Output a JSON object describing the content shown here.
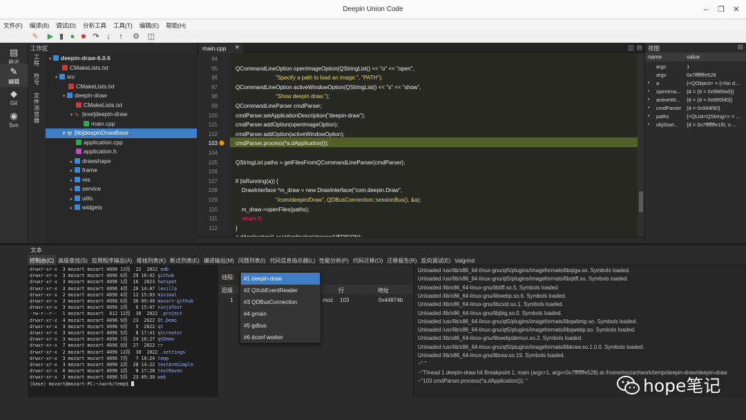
{
  "window": {
    "title": "Deepin Union Code"
  },
  "menu": [
    "文件(F)",
    "编译(B)",
    "调试(D)",
    "分析工具",
    "工具(T)",
    "编辑(E)",
    "帮助(H)"
  ],
  "activity_bar": [
    {
      "label": "最近",
      "icon": "clock-icon"
    },
    {
      "label": "编辑",
      "icon": "edit-icon"
    },
    {
      "label": "Git",
      "icon": "git-icon"
    },
    {
      "label": "Svn",
      "icon": "svn-icon"
    }
  ],
  "workspace": {
    "title": "工作区",
    "vertical_tabs": [
      "工程",
      "符号",
      "文件浏览器"
    ],
    "tree": [
      {
        "label": "deepin-draw-6.0.6",
        "type": "project",
        "expanded": true
      },
      {
        "label": "CMakeLists.txt",
        "type": "cmake"
      },
      {
        "label": "src",
        "type": "folder",
        "expanded": true
      },
      {
        "label": "CMakeLists.txt",
        "type": "cmake"
      },
      {
        "label": "deepin-draw",
        "type": "folder",
        "expanded": true
      },
      {
        "label": "CMakeLists.txt",
        "type": "cmake"
      },
      {
        "label": "[exe]deepin-draw",
        "type": "exe",
        "expanded": true
      },
      {
        "label": "main.cpp",
        "type": "cpp"
      },
      {
        "label": "[lib]deepinDrawBase",
        "type": "lib",
        "expanded": true,
        "selected": true
      },
      {
        "label": "application.cpp",
        "type": "cpp"
      },
      {
        "label": "application.h",
        "type": "header"
      },
      {
        "label": "drawshape",
        "type": "folder"
      },
      {
        "label": "frame",
        "type": "folder"
      },
      {
        "label": "res",
        "type": "folder"
      },
      {
        "label": "service",
        "type": "folder"
      },
      {
        "label": "utils",
        "type": "folder"
      },
      {
        "label": "widgets",
        "type": "folder"
      }
    ]
  },
  "editor": {
    "tab": "main.cpp",
    "current_line": 103,
    "lines": [
      {
        "n": "94",
        "code": ""
      },
      {
        "n": "95",
        "code": "QCommandLineOption openImageOption(QStringList() << \"o\" << \"open\","
      },
      {
        "n": "96",
        "code": "                          \"Specify a path to load an image.\", \"PATH\");"
      },
      {
        "n": "97",
        "code": "QCommandLineOption activeWindowOption(QStringList() << \"s\" << \"show\","
      },
      {
        "n": "98",
        "code": "                          \"Show deepin draw.\");"
      },
      {
        "n": "99",
        "code": "QCommandLineParser cmdParser;"
      },
      {
        "n": "100",
        "code": "cmdParser.setApplicationDescription(\"deepin-draw\");"
      },
      {
        "n": "101",
        "code": "cmdParser.addOption(openImageOption);"
      },
      {
        "n": "102",
        "code": "cmdParser.addOption(activeWindowOption);"
      },
      {
        "n": "103",
        "code": "cmdParser.process(*a.dApplication());"
      },
      {
        "n": "104",
        "code": ""
      },
      {
        "n": "105",
        "code": "QStringList paths = getFilesFromQCommandLineParser(cmdParser);"
      },
      {
        "n": "106",
        "code": ""
      },
      {
        "n": "107",
        "code": "if (isRunning(a)) {"
      },
      {
        "n": "108",
        "code": "    DrawInterface *m_draw = new DrawInterface(\"com.deepin.Draw\","
      },
      {
        "n": "109",
        "code": "                          \"/com/deepin/Draw\", QDBusConnection::sessionBus(), &a);"
      },
      {
        "n": "110",
        "code": "    m_draw->openFiles(paths);"
      },
      {
        "n": "111",
        "code": "    return 0;"
      },
      {
        "n": "112",
        "code": "}"
      },
      {
        "n": "113",
        "code": "a.dApplication()->setApplicationVersion(VERSION);"
      }
    ]
  },
  "variables": {
    "title": "视图",
    "headers": {
      "name": "name",
      "value": "value"
    },
    "rows": [
      {
        "name": "argc",
        "value": "1"
      },
      {
        "name": "argv",
        "value": "0x7fffffffe528"
      },
      {
        "name": "a",
        "value": "{<QObject> = {<No d..."
      },
      {
        "name": "openIma...",
        "value": "{d = {d = 0x9960a0}}"
      },
      {
        "name": "activeWi...",
        "value": "{d = {d = 0x995fd0}}"
      },
      {
        "name": "cmdParser",
        "value": "{d = 0x994f90}"
      },
      {
        "name": "paths",
        "value": "{<QList<QString>> = ..."
      },
      {
        "name": "objStart...",
        "value": "{d = 0x7fffffffe1f0, o ..."
      }
    ]
  },
  "bottom": {
    "title": "文本",
    "tabs": [
      "控制台(C)",
      "高级查找(S)",
      "应用程序输出(A)",
      "堆栈列表(K)",
      "断点列表(E)",
      "编译输出(M)",
      "问题列表(I)",
      "代码信息指示器(L)",
      "性能分析(P)",
      "代码迁移(O)",
      "迁移报告(R)",
      "反向调试(E)",
      "Valgrind"
    ],
    "terminal": [
      {
        "meta": "drwxr-xr-x  3 mozart mozart 4096 12月  22  2022 ",
        "name": "edb"
      },
      {
        "meta": "drwxr-xr-x  3 mozart mozart 4096 6月  29 16:42 ",
        "name": "github"
      },
      {
        "meta": "drwxr-xr-x  3 mozart mozart 4096 1月  16  2023 ",
        "name": "hotspot"
      },
      {
        "meta": "drwxr-xr-x  3 mozart mozart 4096 4月  26 14:07 ",
        "name": "lexilla"
      },
      {
        "meta": "drwxr-xr-x  2 mozart mozart 4096 4月  12 15:03 ",
        "name": "minimal"
      },
      {
        "meta": "drwxr-xr-x  3 mozart mozart 4096 6月  30 09:49 ",
        "name": "mozart-github"
      },
      {
        "meta": "drwxr-xr-x  3 mozart mozart 4096 2月   6 15:47 ",
        "name": "ninjaTest"
      },
      {
        "meta": "-rw-r--r--  1 mozart mozart  812 12月  30  2022 ",
        "name": ".project"
      },
      {
        "meta": "drwxr-xr-x  4 mozart mozart 4096 9月  23  2022 ",
        "name": "Qt.Demo"
      },
      {
        "meta": "drwxr-xr-x  3 mozart mozart 4096 9月   5  2022 ",
        "name": "qt"
      },
      {
        "meta": "drwxr-xr-x  3 mozart mozart 4096 5月   8 17:41 ",
        "name": "qtcreator"
      },
      {
        "meta": "drwxr-xr-x  3 mozart mozart 4096 7月  24 18:27 ",
        "name": "qtDemo"
      },
      {
        "meta": "drwxr-xr-x  7 mozart mozart 4096 9月  27  2022 ",
        "name": "rr"
      },
      {
        "meta": "drwxr-xr-x  2 mozart mozart 4096 12月  30  2022 ",
        "name": ".settings"
      },
      {
        "meta": "drwxr-xr-x  3 mozart mozart 4096 7月   7 10:24 ",
        "name": "temp"
      },
      {
        "meta": "drwxr-xr-x  3 mozart mozart 4096 2月  28 14:22 ",
        "name": "testArmSimple"
      },
      {
        "meta": "drwxr-xr-x  6 mozart mozart 4096 3月   8 17:20 ",
        "name": "testRaven"
      },
      {
        "meta": "drwxr-xr-x  3 mozart mozart 4096 5月  23 09:30 ",
        "name": "web"
      },
      {
        "meta": "(base) mozart@mozart-PC:~/work/temp$ ",
        "name": ""
      }
    ],
    "threads": {
      "label": "线程:",
      "level_header": "层级",
      "col_line": "行",
      "col_addr": "地址",
      "row": {
        "level": "1",
        "file": "moz",
        "line": "103",
        "addr": "0x44874b"
      },
      "options": [
        "#1 deepin-draw",
        "#2 QXcbEventReader",
        "#3 QDBusConnection",
        "#4 gmain",
        "#5 gdbus",
        "#6 dconf worker"
      ]
    },
    "log": [
      "Unloaded /usr/lib/x86_64-linux-gnu/qt5/plugins/imageformats/libqtga.so. Symbols loaded.",
      "Unloaded /usr/lib/x86_64-linux-gnu/qt5/plugins/imageformats/libqtiff.so. Symbols loaded.",
      "Unloaded /lib/x86_64-linux-gnu/libtiff.so.5. Symbols loaded.",
      "Unloaded /lib/x86_64-linux-gnu/libwebp.so.6. Symbols loaded.",
      "Unloaded /lib/x86_64-linux-gnu/libzstd.so.1. Symbols loaded.",
      "Unloaded /lib/x86_64-linux-gnu/libjbig.so.0. Symbols loaded.",
      "Unloaded /usr/lib/x86_64-linux-gnu/qt5/plugins/imageformats/libqwbmp.so. Symbols loaded.",
      "Unloaded /usr/lib/x86_64-linux-gnu/qt5/plugins/imageformats/libqwebp.so. Symbols loaded.",
      "Unloaded /lib/x86_64-linux-gnu/libwebpdemux.so.2. Symbols loaded.",
      "Unloaded /usr/lib/x86_64-linux-gnu/qt5/plugins/imageformats/libkraw.so.1.0.0. Symbols loaded.",
      "Unloaded /lib/x86_64-linux-gnu/libraw.so.19. Symbols loaded.",
      "~\" \"",
      "~\"Thread 1 deepin-draw  hit Breakpoint 1, main (argc=1, argv=0x7fffffffe528) at /home/mozart/work/temp/deepin-draw/deepin-draw",
      "~\"103      cmdParser.process(*a.dApplication()); \""
    ]
  },
  "watermark": {
    "text": "hope笔记"
  }
}
